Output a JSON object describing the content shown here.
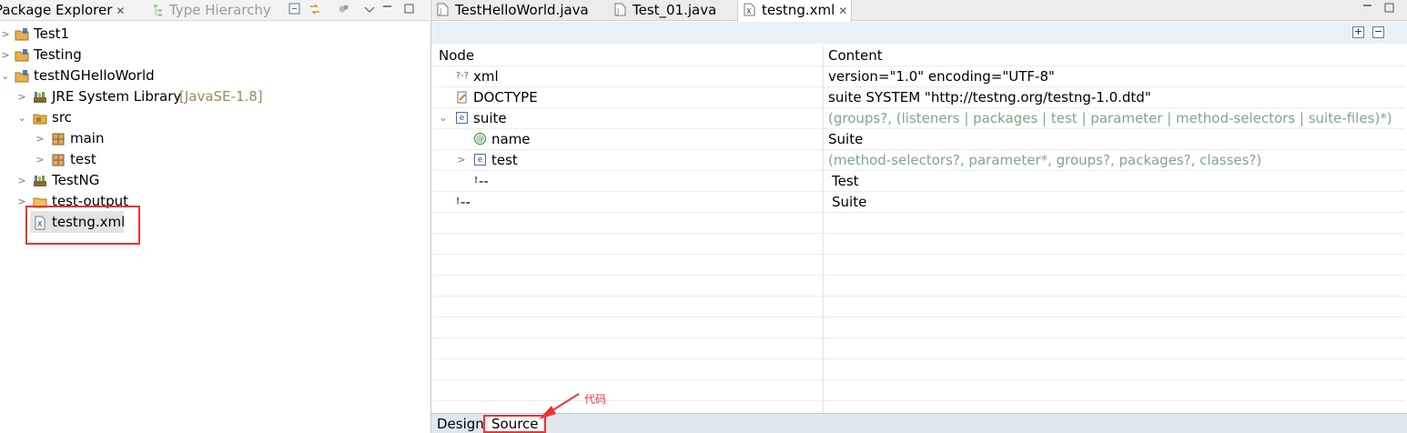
{
  "left_panel": {
    "tabs": {
      "package_explorer": "Package Explorer",
      "type_hierarchy": "Type Hierarchy"
    },
    "tree": [
      {
        "label": "Test1",
        "icon": "java-project-icon"
      },
      {
        "label": "Testing",
        "icon": "java-project-icon"
      },
      {
        "label": "testNGHelloWorld",
        "icon": "java-project-icon"
      },
      {
        "label": "JRE System Library",
        "decoration": "[JavaSE-1.8]",
        "icon": "library-icon"
      },
      {
        "label": "src",
        "icon": "source-folder-icon"
      },
      {
        "label": "main",
        "icon": "package-icon"
      },
      {
        "label": "test",
        "icon": "package-icon"
      },
      {
        "label": "TestNG",
        "icon": "library-icon"
      },
      {
        "label": "test-output",
        "icon": "folder-icon"
      },
      {
        "label": "testng.xml",
        "icon": "xml-file-icon"
      }
    ]
  },
  "editor": {
    "tabs": [
      {
        "label": "TestHelloWorld.java",
        "icon": "java-file-icon"
      },
      {
        "label": "Test_01.java",
        "icon": "java-file-icon"
      },
      {
        "label": "testng.xml",
        "icon": "xml-file-icon",
        "active": true
      }
    ],
    "columns": {
      "node": "Node",
      "content": "Content"
    },
    "rows": [
      {
        "node": "xml",
        "content": "version=\"1.0\" encoding=\"UTF-8\""
      },
      {
        "node": "DOCTYPE",
        "content": "suite SYSTEM \"http://testng.org/testng-1.0.dtd\""
      },
      {
        "node": "suite",
        "content": "(groups?, (listeners | packages | test | parameter | method-selectors | suite-files)*)"
      },
      {
        "node": "name",
        "content": "Suite"
      },
      {
        "node": "test",
        "content": "(method-selectors?, parameter*, groups?, packages?, classes?)"
      },
      {
        "node": "--",
        "content": "Test"
      },
      {
        "node": "--",
        "content": "Suite"
      }
    ],
    "icon_glyphs": {
      "pi": "?-?",
      "attr": "@",
      "elem": "e",
      "comment": "!"
    },
    "bottom_tabs": {
      "design": "Design",
      "source": "Source"
    }
  },
  "annotation": {
    "text": "代码"
  },
  "colors": {
    "highlight": "#ee3333",
    "hint_text": "#7fa68c"
  }
}
